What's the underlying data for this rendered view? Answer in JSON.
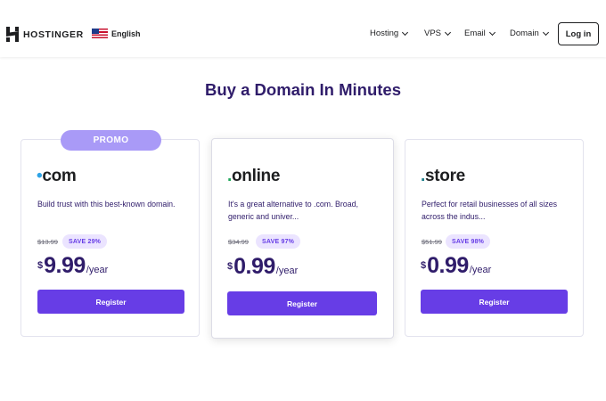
{
  "header": {
    "logo_text": "HOSTINGER",
    "language": "English",
    "nav": [
      {
        "label": "Hosting"
      },
      {
        "label": "VPS"
      },
      {
        "label": "Email"
      },
      {
        "label": "Domain"
      }
    ],
    "login_label": "Log in"
  },
  "page_title": "Buy a Domain In Minutes",
  "promo_label": "PROMO",
  "cards": [
    {
      "tld_dot": "•",
      "tld_name": "com",
      "description": "Build trust with this best-known domain.",
      "old_price": "$13.99",
      "save": "SAVE 29%",
      "currency": "$",
      "price": "9.99",
      "period": "/year",
      "button": "Register"
    },
    {
      "tld_dot": ".",
      "tld_name": "online",
      "description": "It's a great alternative to .com. Broad, generic and univer...",
      "old_price": "$34.99",
      "save": "SAVE 97%",
      "currency": "$",
      "price": "0.99",
      "period": "/year",
      "button": "Register"
    },
    {
      "tld_dot": ".",
      "tld_name": "store",
      "description": "Perfect for retail businesses of all sizes across the indus...",
      "old_price": "$51.99",
      "save": "SAVE 98%",
      "currency": "$",
      "price": "0.99",
      "period": "/year",
      "button": "Register"
    }
  ],
  "colors": {
    "accent": "#673de6",
    "title": "#2f1c6a",
    "promo": "#a99af7",
    "save_bg": "#ebe4ff"
  }
}
